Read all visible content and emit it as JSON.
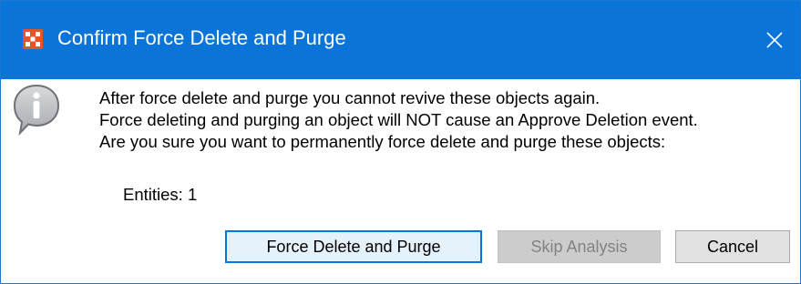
{
  "window": {
    "title": "Confirm Force Delete and Purge",
    "app_icon": "app-logo-icon",
    "close_icon": "close-icon"
  },
  "message": {
    "icon": "info-icon",
    "lines": [
      "After force delete and purge you cannot revive these objects again.",
      "Force deleting and purging an object will NOT cause an Approve Deletion event.",
      "Are you sure you want to permanently force delete and purge these objects:"
    ]
  },
  "summary": {
    "entities": "Entities: 1"
  },
  "buttons": {
    "force_delete": "Force Delete and Purge",
    "skip_analysis": "Skip Analysis",
    "cancel": "Cancel"
  },
  "colors": {
    "titlebar": "#0a74d8",
    "app_icon": "#e8522a",
    "primary_border": "#0078d7",
    "disabled_text": "#838383"
  }
}
